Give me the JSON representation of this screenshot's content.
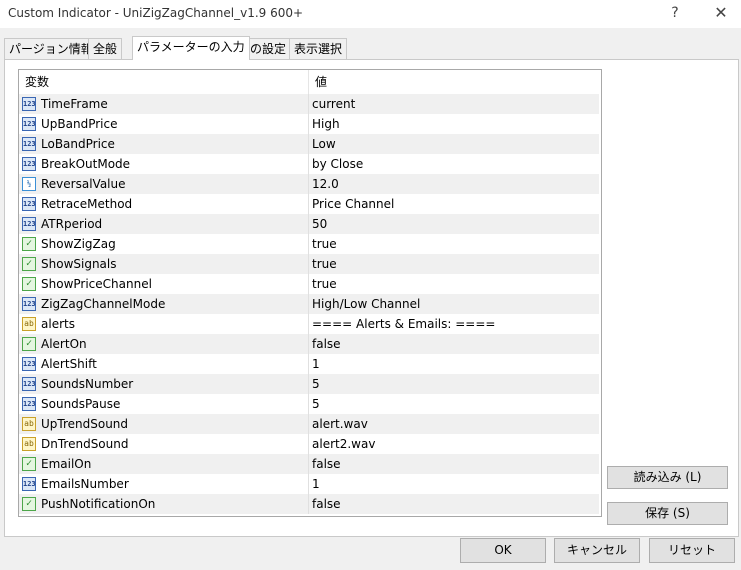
{
  "window": {
    "title": "Custom Indicator - UniZigZagChannel_v1.9 600+",
    "help_label": "?",
    "close_label": "✕"
  },
  "tabs": [
    {
      "label": "パージョン情報",
      "active": false
    },
    {
      "label": "全般",
      "active": false
    },
    {
      "label": "パラメーターの入力",
      "active": true
    },
    {
      "label": "色の設定",
      "active": false
    },
    {
      "label": "表示選択",
      "active": false
    }
  ],
  "grid": {
    "columns": [
      "変数",
      "値"
    ],
    "rows": [
      {
        "type": "int",
        "icon": "123",
        "name": "TimeFrame",
        "value": "current"
      },
      {
        "type": "int",
        "icon": "123",
        "name": "UpBandPrice",
        "value": "High"
      },
      {
        "type": "int",
        "icon": "123",
        "name": "LoBandPrice",
        "value": "Low"
      },
      {
        "type": "int",
        "icon": "123",
        "name": "BreakOutMode",
        "value": "by Close"
      },
      {
        "type": "dbl",
        "icon": "½",
        "name": "ReversalValue",
        "value": "12.0"
      },
      {
        "type": "int",
        "icon": "123",
        "name": "RetraceMethod",
        "value": "Price Channel"
      },
      {
        "type": "int",
        "icon": "123",
        "name": "ATRperiod",
        "value": "50"
      },
      {
        "type": "bool",
        "icon": "✓",
        "name": "ShowZigZag",
        "value": "true"
      },
      {
        "type": "bool",
        "icon": "✓",
        "name": "ShowSignals",
        "value": "true"
      },
      {
        "type": "bool",
        "icon": "✓",
        "name": "ShowPriceChannel",
        "value": "true"
      },
      {
        "type": "int",
        "icon": "123",
        "name": "ZigZagChannelMode",
        "value": "High/Low Channel"
      },
      {
        "type": "str",
        "icon": "ab",
        "name": "alerts",
        "value": "==== Alerts & Emails: ===="
      },
      {
        "type": "bool",
        "icon": "✓",
        "name": "AlertOn",
        "value": "false"
      },
      {
        "type": "int",
        "icon": "123",
        "name": "AlertShift",
        "value": "1"
      },
      {
        "type": "int",
        "icon": "123",
        "name": "SoundsNumber",
        "value": "5"
      },
      {
        "type": "int",
        "icon": "123",
        "name": "SoundsPause",
        "value": "5"
      },
      {
        "type": "str",
        "icon": "ab",
        "name": "UpTrendSound",
        "value": "alert.wav"
      },
      {
        "type": "str",
        "icon": "ab",
        "name": "DnTrendSound",
        "value": "alert2.wav"
      },
      {
        "type": "bool",
        "icon": "✓",
        "name": "EmailOn",
        "value": "false"
      },
      {
        "type": "int",
        "icon": "123",
        "name": "EmailsNumber",
        "value": "1"
      },
      {
        "type": "bool",
        "icon": "✓",
        "name": "PushNotificationOn",
        "value": "false"
      }
    ]
  },
  "buttons": {
    "load": "読み込み (L)",
    "save": "保存 (S)",
    "ok": "OK",
    "cancel": "キャンセル",
    "reset": "リセット"
  }
}
